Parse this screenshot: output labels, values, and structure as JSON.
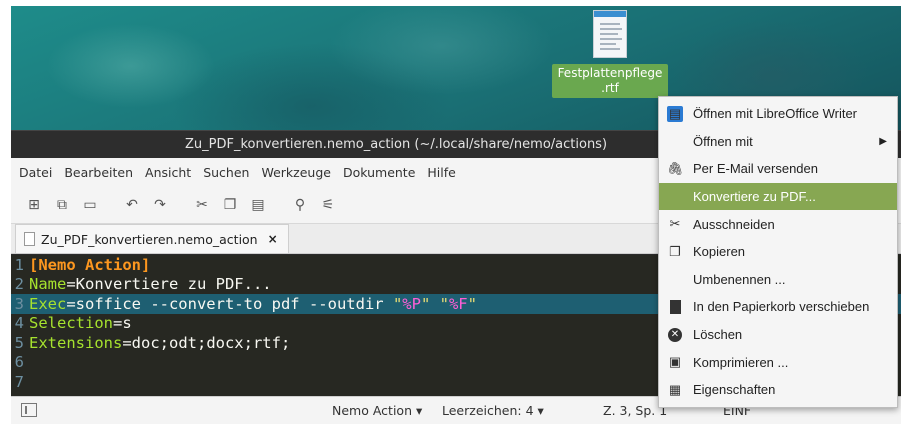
{
  "desktop": {
    "file_label_line1": "Festplattenpflege",
    "file_label_line2": ".rtf"
  },
  "window": {
    "title": "Zu_PDF_konvertieren.nemo_action (~/.local/share/nemo/actions)",
    "menu": [
      "Datei",
      "Bearbeiten",
      "Ansicht",
      "Suchen",
      "Werkzeuge",
      "Dokumente",
      "Hilfe"
    ],
    "toolbar_icons": [
      "new-document-icon",
      "open-icon",
      "save-icon",
      "undo-icon",
      "redo-icon",
      "cut-icon",
      "copy-icon",
      "paste-icon",
      "search-icon",
      "replace-icon"
    ],
    "tab": {
      "label": "Zu_PDF_konvertieren.nemo_action",
      "close": "×"
    }
  },
  "editor": {
    "line_numbers": [
      "1",
      "2",
      "3",
      "4",
      "5",
      "6",
      "7"
    ],
    "l1_header": "[Nemo Action]",
    "l2_key": "Name",
    "l2_value": "=Konvertiere zu PDF...",
    "l3_key": "Exec",
    "l3_value": "=soffice --convert-to pdf --outdir ",
    "l3_q1": "\"",
    "l3_var1": "%P",
    "l3_q2": "\" \"",
    "l3_var2": "%F",
    "l3_q3": "\"",
    "l4_key": "Selection",
    "l4_value": "=s",
    "l5_key": "Extensions",
    "l5_value": "=doc;odt;docx;rtf;"
  },
  "status": {
    "language": "Nemo Action ▾",
    "spaces": "Leerzeichen: 4 ▾",
    "position": "Z. 3, Sp. 1",
    "mode": "EINF"
  },
  "context_menu": {
    "items": [
      {
        "label": "Öffnen mit LibreOffice Writer",
        "icon": "libreoffice-writer-icon"
      },
      {
        "label": "Öffnen mit",
        "icon": "",
        "submenu": "▶"
      },
      {
        "label": "Per E-Mail versenden",
        "icon": "paperclip-icon"
      },
      {
        "label": "Konvertiere zu PDF...",
        "icon": ""
      },
      {
        "label": "Ausschneiden",
        "icon": "scissors-icon"
      },
      {
        "label": "Kopieren",
        "icon": "copy-icon"
      },
      {
        "label": "Umbenennen ...",
        "icon": ""
      },
      {
        "label": "In den Papierkorb verschieben",
        "icon": "trash-icon"
      },
      {
        "label": "Löschen",
        "icon": "delete-icon"
      },
      {
        "label": "Komprimieren ...",
        "icon": "archive-icon"
      },
      {
        "label": "Eigenschaften",
        "icon": "properties-icon"
      }
    ]
  },
  "colors": {
    "selection": "#87a752",
    "editor_bg": "#272822",
    "current_line": "#1e5f72"
  }
}
